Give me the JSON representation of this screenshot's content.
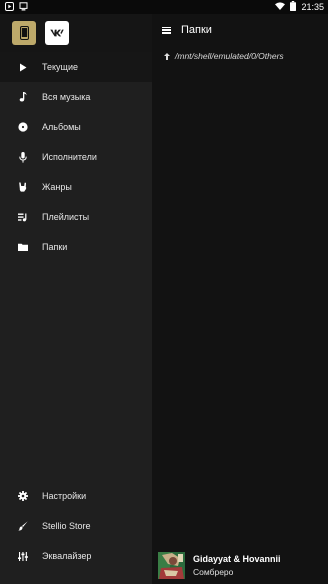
{
  "status_bar": {
    "time": "21:35",
    "battery_icon": "battery-icon",
    "wifi_icon": "wifi-icon"
  },
  "drawer": {
    "source_buttons": [
      {
        "name": "phone-source",
        "icon": "phone-icon"
      },
      {
        "name": "vk-source",
        "icon": "vk-icon",
        "label": "VK"
      }
    ],
    "items": [
      {
        "label": "Текущие",
        "icon": "play-icon",
        "active": true
      },
      {
        "label": "Вся музыка",
        "icon": "music-note-icon"
      },
      {
        "label": "Альбомы",
        "icon": "album-icon"
      },
      {
        "label": "Исполнители",
        "icon": "microphone-icon"
      },
      {
        "label": "Жанры",
        "icon": "hand-icon"
      },
      {
        "label": "Плейлисты",
        "icon": "playlist-icon"
      },
      {
        "label": "Папки",
        "icon": "folder-icon"
      }
    ],
    "bottom_items": [
      {
        "label": "Настройки",
        "icon": "settings-icon"
      },
      {
        "label": "Stellio Store",
        "icon": "brush-icon"
      },
      {
        "label": "Эквалайзер",
        "icon": "equalizer-icon"
      }
    ]
  },
  "main": {
    "title": "Папки",
    "path": "/mnt/shell/emulated/0/Others"
  },
  "player": {
    "title": "Gidayyat & Hovannii",
    "subtitle": "Сомбреро"
  },
  "colors": {
    "accent": "#bda96a",
    "drawer_bg": "#1f1f1f",
    "main_bg": "#121212"
  }
}
